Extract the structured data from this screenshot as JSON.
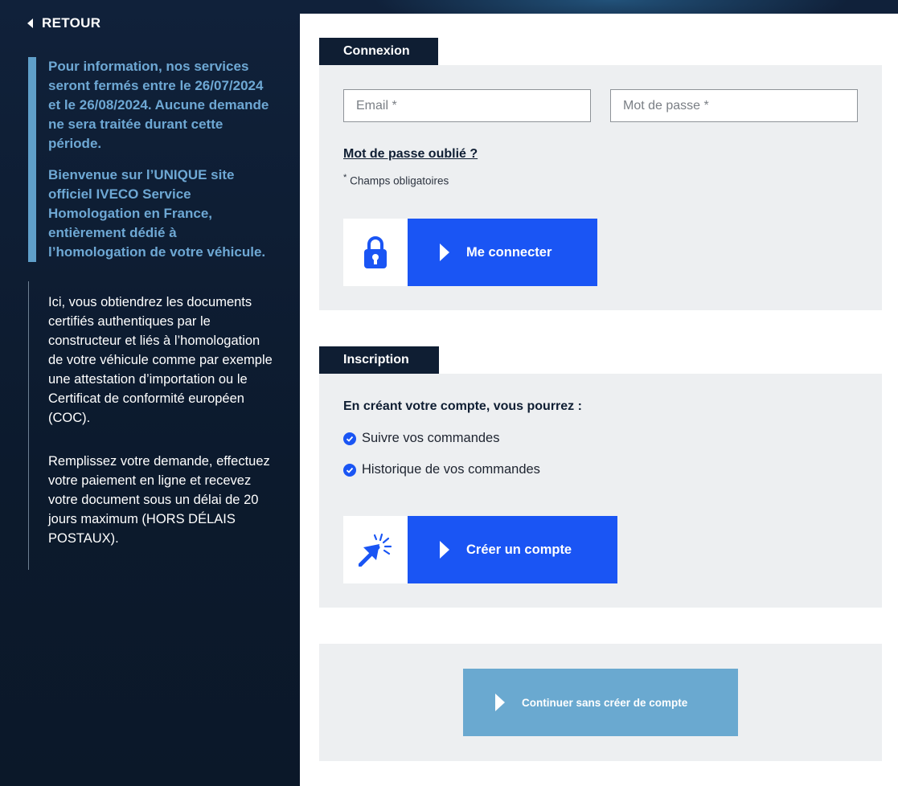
{
  "sidebar": {
    "back_label": "RETOUR",
    "notice": {
      "closure": "Pour information, nos services seront fermés entre le 26/07/2024 et le 26/08/2024. Aucune demande ne sera traitée durant cette période.",
      "welcome": "Bienvenue sur l’UNIQUE site officiel IVECO Service Homologation en France, entièrement dédié à l’homologation de votre véhicule."
    },
    "info": {
      "paragraph1": "Ici, vous obtiendrez les documents certifiés authentiques par le constructeur et liés à l’homologation de votre véhicule comme par exemple une attestation d’importation ou le Certificat de conformité européen (COC).",
      "paragraph2": "Remplissez votre demande, effectuez votre paiement en ligne et recevez votre document sous un délai de 20 jours maximum (HORS DÉLAIS POSTAUX)."
    }
  },
  "login": {
    "tab_label": "Connexion",
    "email_placeholder": "Email *",
    "password_placeholder": "Mot de passe *",
    "forgot_password": "Mot de passe oublié ?",
    "required_mark": "*",
    "required_note": "Champs obligatoires",
    "button_label": "Me connecter",
    "button_icon": "lock-icon"
  },
  "signup": {
    "tab_label": "Inscription",
    "intro": "En créant votre compte, vous pourrez :",
    "benefits": [
      "Suivre vos commandes",
      "Historique de vos commandes"
    ],
    "button_label": "Créer un compte",
    "button_icon": "cursor-click-icon"
  },
  "guest": {
    "button_label": "Continuer sans créer de compte"
  },
  "colors": {
    "navy": "#0f1e33",
    "accent_blue": "#1a55f4",
    "light_blue": "#6aa9d0",
    "notice_text": "#6ea8d4",
    "panel_gray": "#edeff1"
  }
}
